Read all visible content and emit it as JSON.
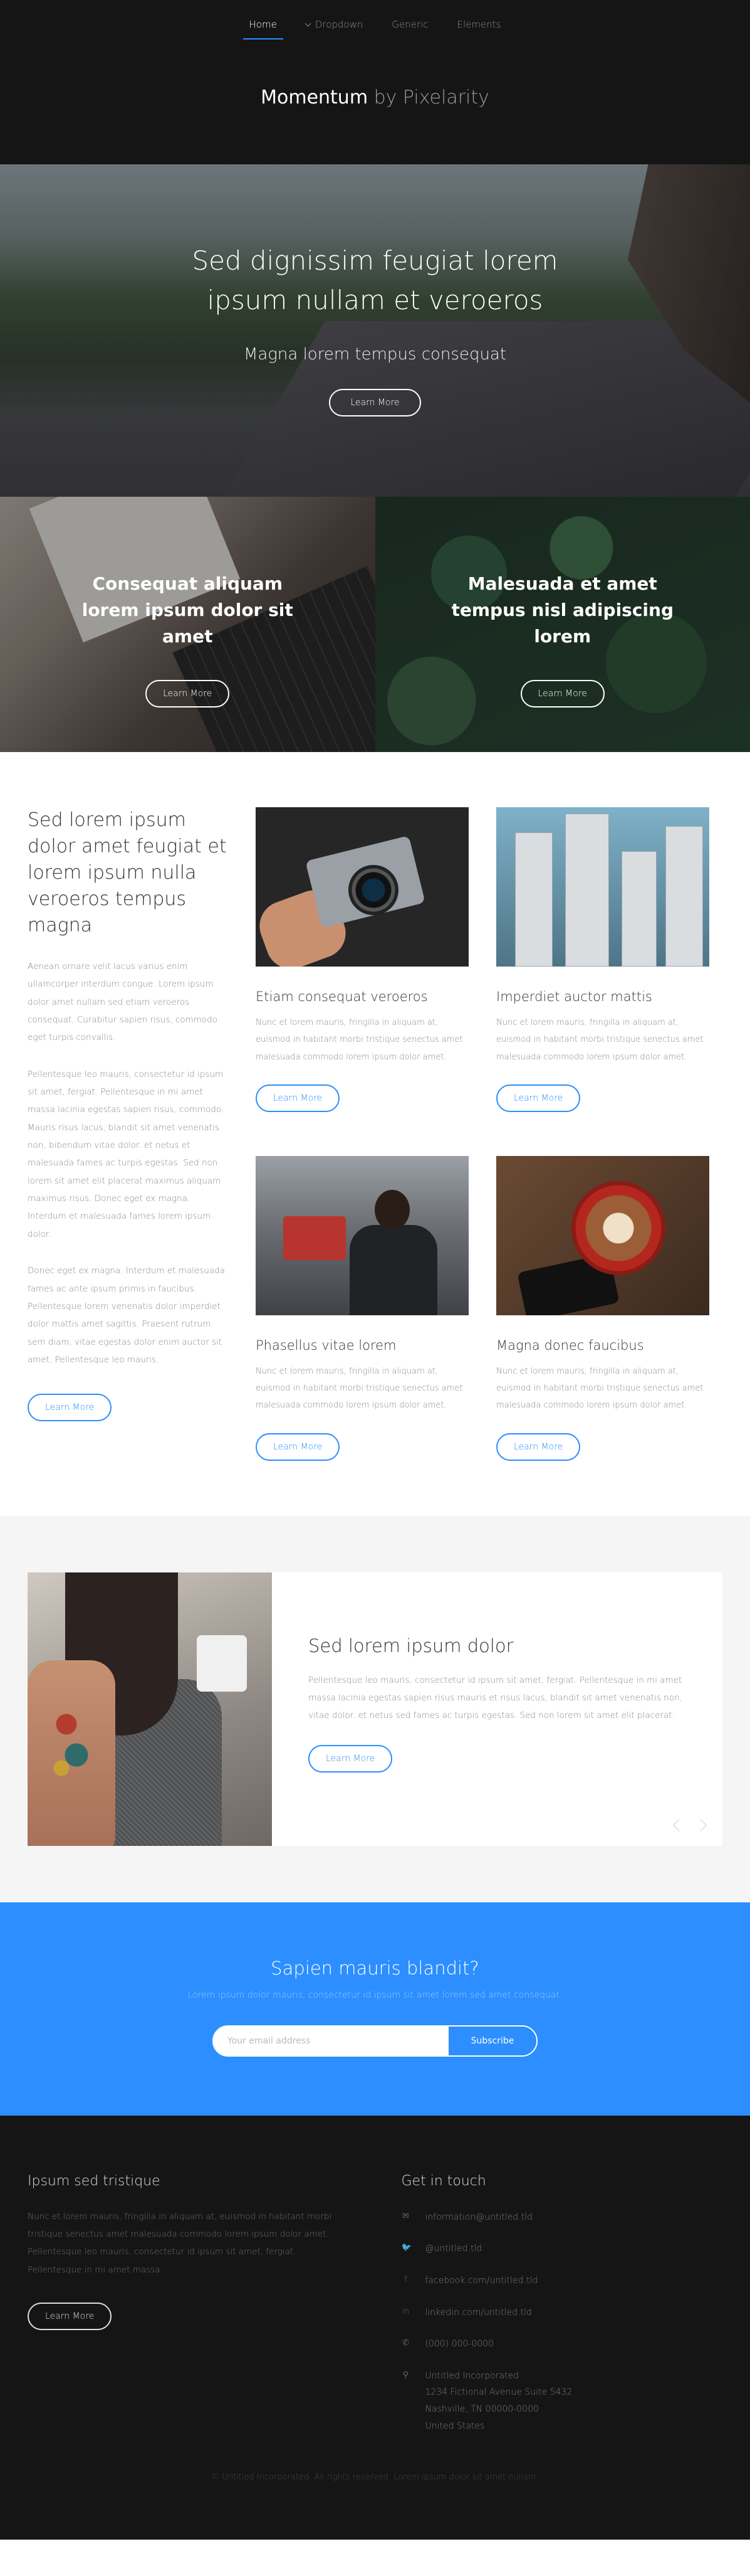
{
  "nav": {
    "items": [
      {
        "label": "Home",
        "active": true
      },
      {
        "label": "Dropdown",
        "active": false
      },
      {
        "label": "Generic",
        "active": false
      },
      {
        "label": "Elements",
        "active": false
      }
    ]
  },
  "logo": {
    "brand": "Momentum",
    "by": "by Pixelarity"
  },
  "hero": {
    "title": "Sed dignissim feugiat lorem ipsum nullam et veroeros",
    "subtitle": "Magna lorem tempus consequat",
    "button": "Learn More"
  },
  "tiles": [
    {
      "title": "Consequat aliquam lorem ipsum dolor sit amet",
      "button": "Learn More"
    },
    {
      "title": "Malesuada et amet tempus nisl adipiscing lorem",
      "button": "Learn More"
    }
  ],
  "intro": {
    "heading": "Sed lorem ipsum dolor amet feugiat et lorem ipsum nulla veroeros tempus magna",
    "paragraphs": [
      "Aenean ornare velit lacus varius enim ullamcorper interdum congue. Lorem ipsum dolor amet nullam sed etiam veroeros consequat. Curabitur sapien risus, commodo eget turpis convallis.",
      "Pellentesque leo mauris, consectetur id ipsum sit amet, fergiat. Pellentesque in mi amet massa lacinia egestas sapien risus, commodo. Mauris risus lacus, blandit sit amet venenatis non, bibendum vitae dolor. et netus et malesuada fames ac turpis egestas. Sed non lorem sit amet elit placerat maximus aliquam maximus risus. Donec eget ex magna. Interdum et malesuada fames lorem ipsum dolor.",
      "Donec eget ex magna. Interdum et malesuada fames ac ante ipsum primis in faucibus. Pellentesque lorem venenatis dolor imperdiet dolor mattis amet sagittis. Praesent rutrum sem diam, vitae egestas dolor enim auctor sit amet. Pellentesque leo mauris."
    ],
    "button": "Learn More"
  },
  "cards": [
    {
      "title": "Etiam consequat veroeros",
      "text": "Nunc et lorem mauris, fringilla in aliquam at, euismod in habitant morbi tristique senectus amet malesuada commodo lorem ipsum dolor amet.",
      "button": "Learn More"
    },
    {
      "title": "Imperdiet auctor mattis",
      "text": "Nunc et lorem mauris, fringilla in aliquam at, euismod in habitant morbi tristique senectus amet malesuada commodo lorem ipsum dolor amet.",
      "button": "Learn More"
    },
    {
      "title": "Phasellus vitae lorem",
      "text": "Nunc et lorem mauris, fringilla in aliquam at, euismod in habitant morbi tristique senectus amet malesuada commodo lorem ipsum dolor amet.",
      "button": "Learn More"
    },
    {
      "title": "Magna donec faucibus",
      "text": "Nunc et lorem mauris, fringilla in aliquam at, euismod in habitant morbi tristique senectus amet malesuada commodo lorem ipsum dolor amet.",
      "button": "Learn More"
    }
  ],
  "testimonial": {
    "title": "Sed lorem ipsum dolor",
    "text": "Pellentesque leo mauris, consectetur id ipsum sit amet, fergiat. Pellentesque in mi amet massa lacinia egestas sapien risus mauris et risus lacus, blandit sit amet venenatis non, vitae dolor. et netus sed fames ac turpis egestas. Sed non lorem sit amet elit placerat.",
    "button": "Learn More"
  },
  "signup": {
    "title": "Sapien mauris blandit?",
    "subtitle": "Lorem ipsum dolor mauris, consectetur id ipsum sit amet lorem sed amet consequat.",
    "placeholder": "Your email address",
    "button": "Subscribe"
  },
  "footer": {
    "about": {
      "title": "Ipsum sed tristique",
      "text": "Nunc et lorem mauris, fringilla in aliquam at, euismod in habitant morbi tristique senectus amet malesuada commodo lorem ipsum dolor amet. Pellentesque leo mauris, consectetur id ipsum sit amet, fergiat. Pellentesque in mi amet massa.",
      "button": "Learn More"
    },
    "contact": {
      "title": "Get in touch",
      "items": [
        {
          "icon": "envelope-icon",
          "glyph": "✉",
          "text": "information@untitled.tld"
        },
        {
          "icon": "twitter-icon",
          "glyph": "🐦",
          "text": "@untitled.tld"
        },
        {
          "icon": "facebook-icon",
          "glyph": "f",
          "text": "facebook.com/untitled.tld"
        },
        {
          "icon": "linkedin-icon",
          "glyph": "in",
          "text": "linkedin.com/untitled.tld"
        },
        {
          "icon": "phone-icon",
          "glyph": "✆",
          "text": "(000) 000-0000"
        },
        {
          "icon": "map-marker-icon",
          "glyph": "⚲",
          "lines": [
            "Untitled Incorporated",
            "1234 Fictional Avenue Suite 5432",
            "Nashville, TN 00000-0000",
            "United States"
          ]
        }
      ]
    },
    "copyright": "© Untitled Incorporated. All rights reserved. Lorem ipsum dolor sit amet nullam."
  },
  "colors": {
    "accent": "#2c8eff",
    "dark": "#151515"
  }
}
